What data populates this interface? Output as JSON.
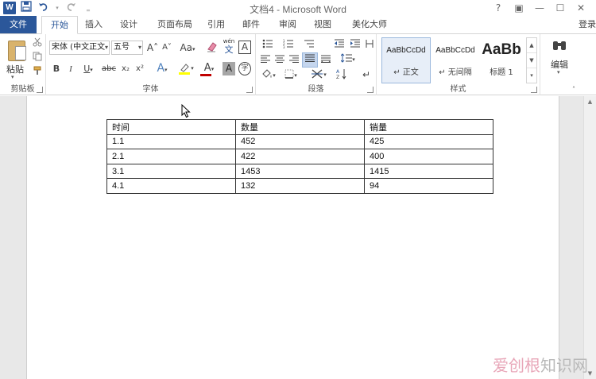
{
  "window": {
    "title": "文档4 - Microsoft Word",
    "app_logo": "W",
    "controls": [
      "?",
      "▣",
      "—",
      "☐",
      "✕"
    ]
  },
  "qat": {
    "save_icon": "save-icon",
    "undo_icon": "undo-icon",
    "redo_icon": "redo-icon",
    "customize_icon": "chevron-down-icon"
  },
  "tabs": [
    {
      "label": "文件"
    },
    {
      "label": "开始"
    },
    {
      "label": "插入"
    },
    {
      "label": "设计"
    },
    {
      "label": "页面布局"
    },
    {
      "label": "引用"
    },
    {
      "label": "邮件"
    },
    {
      "label": "审阅"
    },
    {
      "label": "视图"
    },
    {
      "label": "美化大师"
    }
  ],
  "login": "登录",
  "ribbon": {
    "clipboard": {
      "label": "剪贴板",
      "paste": "粘贴"
    },
    "font": {
      "label": "字体",
      "font_name": "宋体 (中文正文",
      "font_size": "五号",
      "grow": "A˄",
      "shrink": "A˅",
      "case": "Aa",
      "clear_format_icon": "eraser-icon",
      "phonetic": "wén",
      "phonetic_char": "文",
      "border_char": "A",
      "bold": "B",
      "italic": "I",
      "underline": "U",
      "strike": "abc",
      "subscript": "x₂",
      "superscript": "x²",
      "effects": "A",
      "highlight_icon": "highlighter-icon",
      "font_color": "A",
      "shading": "A",
      "enclose": "字"
    },
    "paragraph": {
      "label": "段落"
    },
    "styles": {
      "label": "样式",
      "items": [
        {
          "sample": "AaBbCcDd",
          "name": "↵ 正文"
        },
        {
          "sample": "AaBbCcDd",
          "name": "↵ 无间隔"
        },
        {
          "sample": "AaBb",
          "name": "标题 1"
        }
      ]
    },
    "editing": {
      "label": "编辑"
    }
  },
  "table": {
    "rows": [
      [
        "时间",
        "数量",
        "销量"
      ],
      [
        "1.1",
        "452",
        "425"
      ],
      [
        "2.1",
        "422",
        "400"
      ],
      [
        "3.1",
        "1453",
        "1415"
      ],
      [
        "4.1",
        "132",
        "94"
      ]
    ]
  },
  "watermark": {
    "part1": "爱创根",
    "part2": "知识网"
  },
  "colors": {
    "accent": "#2b579a",
    "highlight": "#ffff00",
    "font_color_bar": "#c00000"
  }
}
